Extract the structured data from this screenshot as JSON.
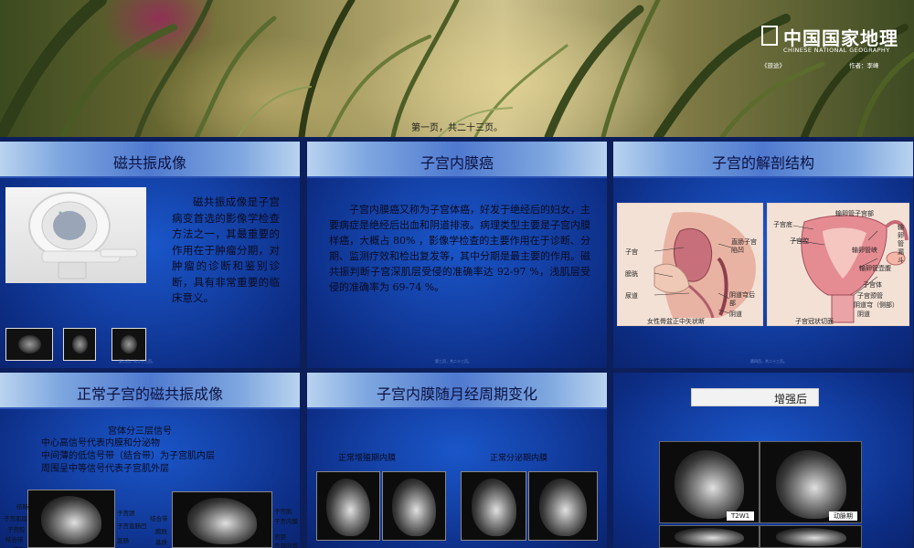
{
  "banner": {
    "logo_main": "中国国家地理",
    "logo_sub": "CHINESE NATIONAL GEOGRAPHY",
    "logo_left": "《旅途》",
    "logo_right": "作者：李峰",
    "page_info": "第一页，共二十三页。"
  },
  "slides": [
    {
      "title": "磁共振成像",
      "body": "磁共振成像是子宫病变首选的影像学检查方法之一，其最重要的作用在于肿瘤分期，对肿瘤的诊断和鉴别诊断，具有非常重要的临床意义。",
      "footer": "第二页，共二十三页。"
    },
    {
      "title": "子宫内膜癌",
      "body": "子宫内膜癌又称为子宫体癌，好发于绝经后的妇女，主要病症是绝经后出血和阴道排液。病理类型主要是子宫内膜样癌，大概占 80% ，影像学检查的主要作用在于诊断、分期、监测疗效和检出复发等，其中分期是最主要的作用。磁共振判断子宫深肌层受侵的准确率达 92-97 %，浅肌层受侵的准确率为 69-74 %。",
      "footer": "第三页，共二十三页。"
    },
    {
      "title": "子宫的解剖结构",
      "labels_left": [
        "子宫",
        "膀胱",
        "尿道",
        "直肠子宫陷凹",
        "阴道穹后部",
        "阴道"
      ],
      "caption_left": "女性骨盆正中矢状断",
      "labels_right": [
        "子宫底",
        "子宫腔",
        "输卵管子宫部",
        "输卵管峡",
        "输卵管壶腹",
        "输卵管漏斗",
        "子宫体",
        "子宫颈管",
        "阴道穹（侧部）",
        "阴道"
      ],
      "caption_right": "子宫冠状切面",
      "footer": "第四页，共二十三页。"
    },
    {
      "title": "正常子宫的磁共振成像",
      "heading": "宫体分三层信号",
      "lines": [
        "中心高信号代表内膜和分泌物",
        "中间薄的低信号带（结合带）为子宫肌内层",
        "周围呈中等信号代表子宫肌外层"
      ],
      "scan_left_labels": [
        "结肠",
        "子宫肌层",
        "子宫腔",
        "结合带",
        "膀胱",
        "子宫颈",
        "子宫直肠凹",
        "直肠"
      ],
      "scan_right_labels": [
        "结合带",
        "膀胱",
        "基质",
        "子宫肌",
        "子宫内膜",
        "宫颈",
        "宫颈内管"
      ]
    },
    {
      "title": "子宫内膜随月经周期变化",
      "caption_left": "正常增殖期内膜",
      "caption_right": "正常分泌期内膜"
    },
    {
      "title": "增强后",
      "tag_left": "T2W1",
      "tag_right": "动脉期"
    }
  ]
}
